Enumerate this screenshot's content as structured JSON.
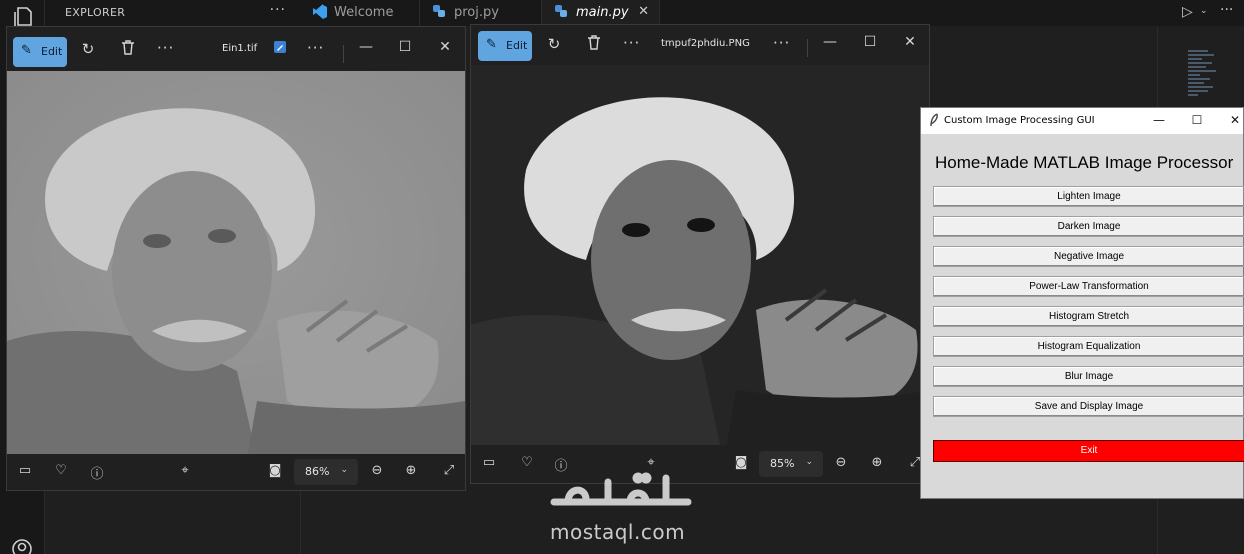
{
  "vscode": {
    "explorer_title": "EXPLORER",
    "explorer_more": "···",
    "tabs": [
      {
        "label": "Welcome",
        "icon": "vscode-icon"
      },
      {
        "label": "proj.py",
        "icon": "python-icon"
      },
      {
        "label": "main.py",
        "icon": "python-icon",
        "active": true,
        "close": "✕"
      }
    ],
    "run_icon": "▷",
    "run_caret": "⌄",
    "run_more": "···"
  },
  "photo_left": {
    "edit_label": "Edit",
    "filename": "Ein1.tif",
    "zoom": "86%",
    "more": "···"
  },
  "photo_right": {
    "edit_label": "Edit",
    "filename": "tmpuf2phdiu.PNG",
    "zoom": "85%",
    "more": "···"
  },
  "tk_gui": {
    "window_title": "Custom Image Processing GUI",
    "heading": "Home-Made MATLAB Image Processor",
    "buttons": [
      "Lighten Image",
      "Darken Image",
      "Negative Image",
      "Power-Law Transformation",
      "Histogram Stretch",
      "Histogram Equalization",
      "Blur Image",
      "Save and Display Image"
    ],
    "exit_label": "Exit",
    "exit_color": "#ff0000"
  },
  "watermark": {
    "domain": "mostaql.com"
  },
  "colors": {
    "edit_accent": "#60a5e0",
    "vscode_bg": "#1f1f1f",
    "tk_bg": "#d9d9d9"
  }
}
